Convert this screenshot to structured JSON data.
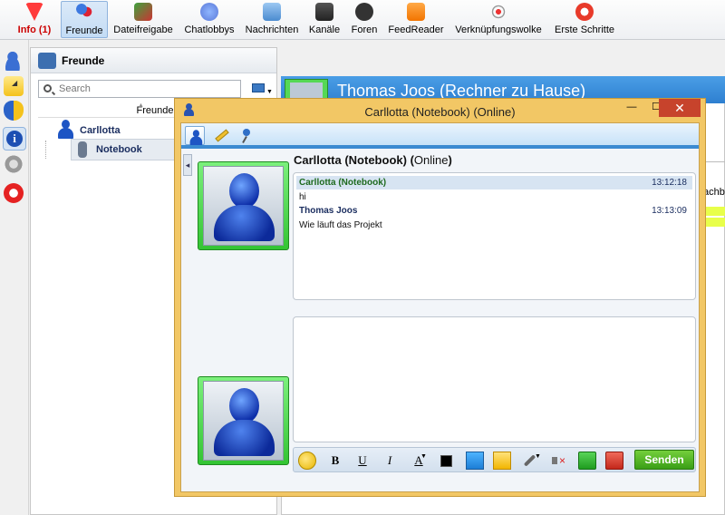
{
  "toolbar": {
    "items": [
      {
        "label": "Info (1)",
        "icon": "heart-down-icon"
      },
      {
        "label": "Freunde",
        "icon": "friends-icon"
      },
      {
        "label": "Dateifreigabe",
        "icon": "file-share-icon"
      },
      {
        "label": "Chatlobbys",
        "icon": "chat-lobby-icon"
      },
      {
        "label": "Nachrichten",
        "icon": "messages-icon"
      },
      {
        "label": "Kanäle",
        "icon": "channels-icon"
      },
      {
        "label": "Foren",
        "icon": "forums-icon"
      },
      {
        "label": "FeedReader",
        "icon": "rss-icon"
      },
      {
        "label": "Verknüpfungswolke",
        "icon": "signal-icon"
      },
      {
        "label": "Erste Schritte",
        "icon": "lifebuoy-icon"
      }
    ],
    "active": "Freunde",
    "colors": {
      "info": "#cc0000",
      "active_bg": "#c3dcf5"
    }
  },
  "leftbar": {
    "icons": [
      "add-friend-icon",
      "add-folder-icon",
      "shield-icon",
      "info-icon",
      "settings-icon",
      "power-icon"
    ]
  },
  "friends": {
    "title": "Freunde",
    "search_placeholder": "Search",
    "column_header": "Freunde",
    "tree": [
      {
        "name": "Carllotta",
        "children": [
          {
            "name": "Notebook"
          }
        ]
      }
    ]
  },
  "contact_panel": {
    "title": "Thomas Joos (Rechner zu Hause)",
    "partial_column": "achb"
  },
  "chat": {
    "window_title": "Carllotta (Notebook) (Online)",
    "contact_name": "Carllotta (Notebook)",
    "status_open": "(",
    "status": "Online",
    "status_close": ")",
    "messages": [
      {
        "sender": "Carllotta (Notebook)",
        "time": "13:12:18",
        "text": "hi"
      },
      {
        "sender": "Thomas Joos",
        "time": "13:13:09",
        "text": "Wie läuft das Projekt"
      }
    ],
    "compose_value": "",
    "format": {
      "bold": "B",
      "underline": "U",
      "italic": "I",
      "font": "A"
    },
    "send_label": "Senden",
    "colors": {
      "window_border": "#f2c765",
      "send": "#3a9e16",
      "header_highlight": "#d7e4f2"
    }
  }
}
